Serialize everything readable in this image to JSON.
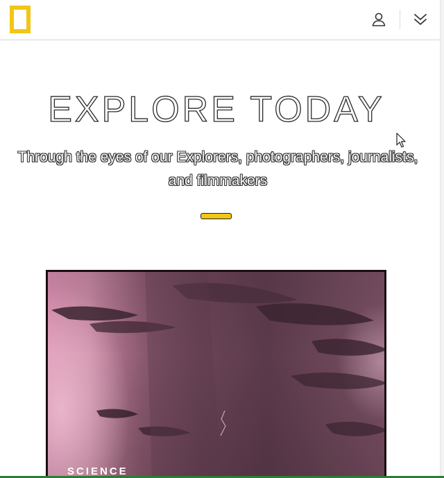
{
  "header": {
    "logo_alt": "National Geographic",
    "user_icon": "user-icon",
    "menu_icon": "double-chevron-down-icon",
    "accent_color": "#f2c614"
  },
  "hero": {
    "title": "EXPLORE TODAY",
    "subtitle": "Through the eyes of our Explorers, photographers, journalists, and filmmakers"
  },
  "feature": {
    "tag": "SCIENCE"
  },
  "colors": {
    "brand_yellow": "#f2c614",
    "bottom_line": "#2e7d32"
  }
}
